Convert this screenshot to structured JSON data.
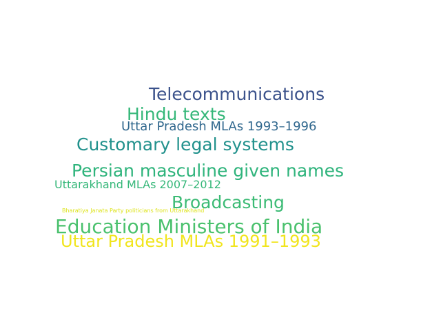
{
  "word_cloud": {
    "words": [
      {
        "text": "Telecommunications",
        "color": "#3b528b"
      },
      {
        "text": "Hindu texts",
        "color": "#35b779"
      },
      {
        "text": "Uttar Pradesh MLAs 1993–1996",
        "color": "#31688e"
      },
      {
        "text": "Customary legal systems",
        "color": "#21918c"
      },
      {
        "text": "Persian masculine given names",
        "color": "#2fb47c"
      },
      {
        "text": "Uttarakhand MLAs 2007–2012",
        "color": "#35b779"
      },
      {
        "text": "Broadcasting",
        "color": "#3cbb75"
      },
      {
        "text": "Bharatiya Janata Party politicians from Uttarakhand",
        "color": "#dde318"
      },
      {
        "text": "Education Ministers of India",
        "color": "#4ac16d"
      },
      {
        "text": "Uttar Pradesh MLAs 1991–1993",
        "color": "#f1e51d"
      }
    ]
  }
}
